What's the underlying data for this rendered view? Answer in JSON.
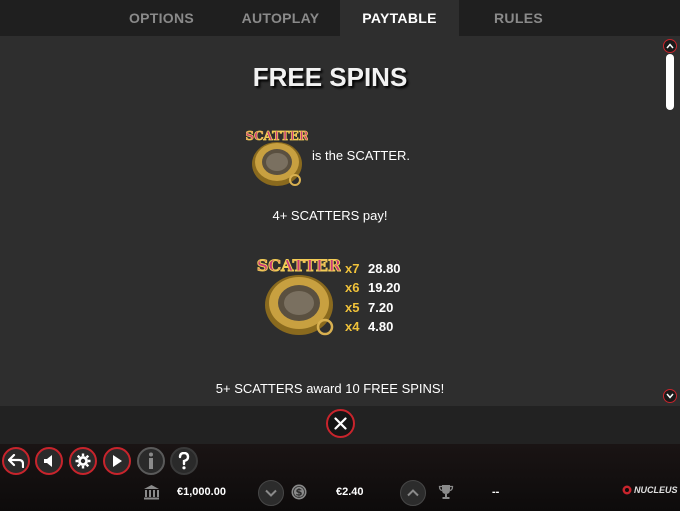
{
  "tabs": [
    {
      "label": "OPTIONS",
      "active": false
    },
    {
      "label": "AUTOPLAY",
      "active": false
    },
    {
      "label": "PAYTABLE",
      "active": true
    },
    {
      "label": "RULES",
      "active": false
    }
  ],
  "paytable": {
    "title": "FREE SPINS",
    "scatter_badge": "SCATTER",
    "is_scatter_text": "is the SCATTER.",
    "pay_note": "4+ SCATTERS pay!",
    "payouts": [
      {
        "count": "x7",
        "value": "28.80"
      },
      {
        "count": "x6",
        "value": "19.20"
      },
      {
        "count": "x5",
        "value": "7.20"
      },
      {
        "count": "x4",
        "value": "4.80"
      }
    ],
    "award_text": "5+ SCATTERS award 10 FREE SPINS!"
  },
  "bottom_bar": {
    "balance": "€1,000.00",
    "bet": "€2.40",
    "win": "--",
    "logo_text": "NUCLEUS"
  },
  "colors": {
    "accent_red": "#c8242c",
    "payout_gold": "#f0c23a",
    "panel_bg": "#2e2e2e"
  },
  "icons": [
    "back-icon",
    "sound-icon",
    "settings-icon",
    "play-icon",
    "info-icon",
    "help-icon",
    "bank-icon",
    "chevron-down-icon",
    "coin-icon",
    "chevron-up-icon",
    "trophy-icon",
    "close-icon"
  ]
}
